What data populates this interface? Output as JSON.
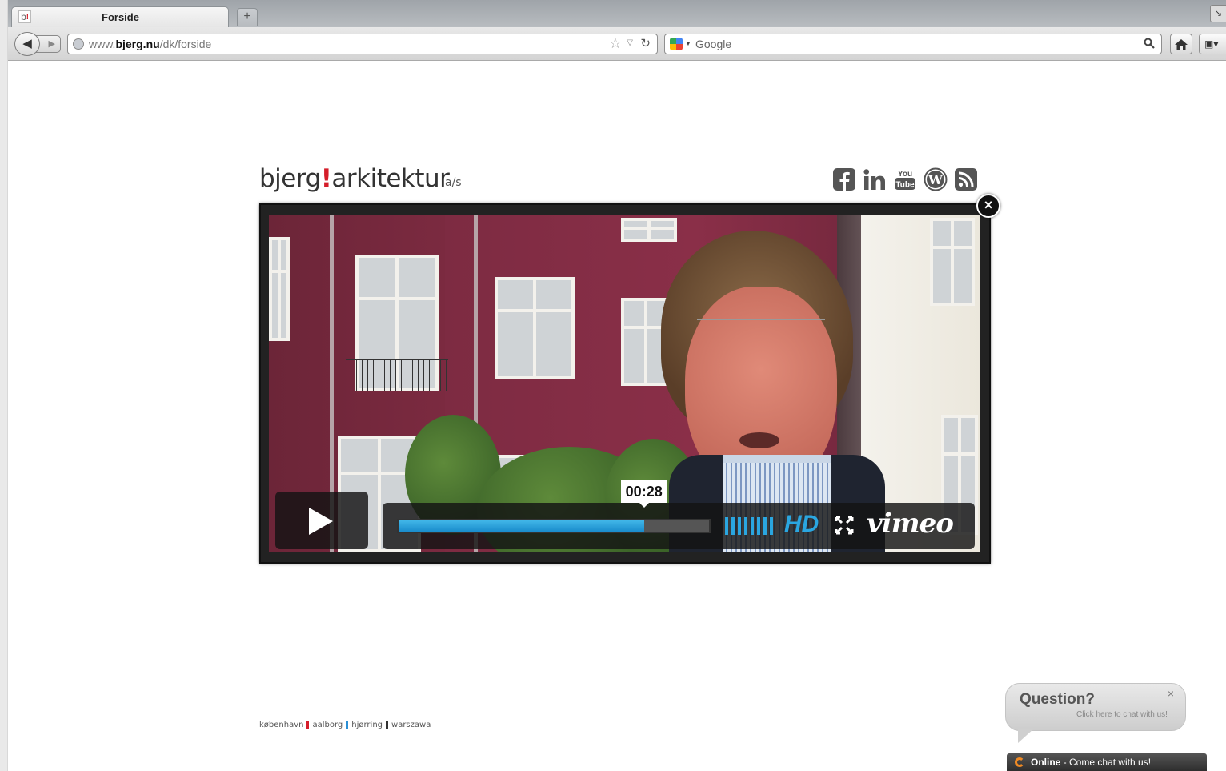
{
  "browser": {
    "tab_title": "Forside",
    "favicon_text": "b",
    "favicon_accent": "!",
    "new_tab_label": "+",
    "url_host": "www.",
    "url_domain": "bjerg.nu",
    "url_path": "/dk/forside",
    "search_engine": "Google"
  },
  "logo": {
    "part1": "bjerg",
    "accent": "!",
    "part2": "arkitektur",
    "suffix": "a/s"
  },
  "social": [
    {
      "name": "facebook-icon"
    },
    {
      "name": "linkedin-icon"
    },
    {
      "name": "youtube-icon"
    },
    {
      "name": "wordpress-icon"
    },
    {
      "name": "rss-icon"
    }
  ],
  "video": {
    "current_time": "00:28",
    "progress": 0.79,
    "hd_label": "HD",
    "brand": "vimeo"
  },
  "footer": {
    "cities": [
      "københavn",
      "aalborg",
      "hjørring",
      "warszawa"
    ],
    "separator_colors": [
      "#d51e2a",
      "#2a8fd6",
      "#333333"
    ]
  },
  "chat": {
    "question": "Question?",
    "subtitle": "Click here to chat with us!",
    "close": "×",
    "status": "Online",
    "status_message": " - Come chat with us!"
  },
  "colors": {
    "accent": "#d51e2a",
    "player_blue": "#2aa6e0"
  }
}
